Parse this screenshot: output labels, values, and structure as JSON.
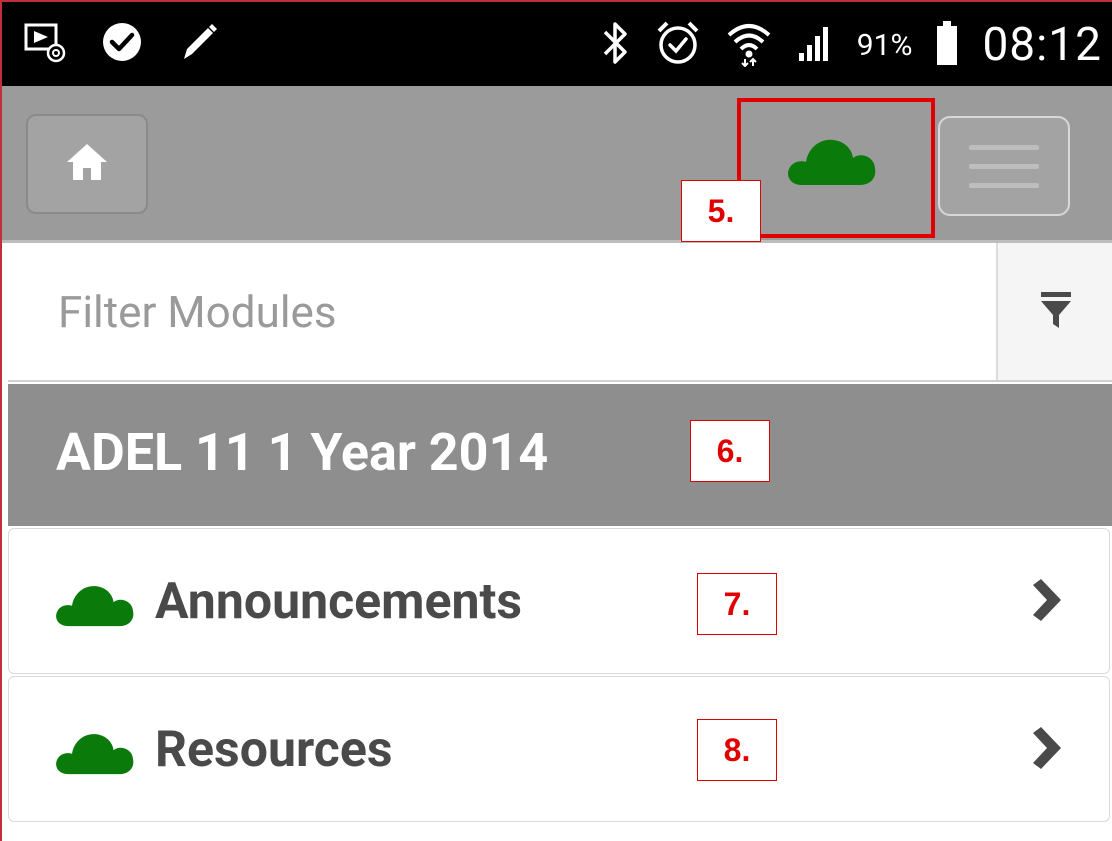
{
  "status_bar": {
    "icons": [
      "screencast-email-icon",
      "skype-icon",
      "pencil-icon",
      "bluetooth-icon",
      "alarm-icon",
      "wifi-icon",
      "signal-icon",
      "battery-icon"
    ],
    "battery": "91%",
    "time": "08:12"
  },
  "toolbar": {
    "home_icon": "home-icon",
    "sync_icon": "cloud-icon",
    "menu_icon": "hamburger-icon"
  },
  "filter": {
    "placeholder": "Filter Modules",
    "value": "",
    "filter_icon": "funnel-icon"
  },
  "section": {
    "title": "ADEL 11 1 Year 2014"
  },
  "items": [
    {
      "label": "Announcements",
      "icon": "cloud-icon",
      "chevron": "chevron-right-icon"
    },
    {
      "label": "Resources",
      "icon": "cloud-icon",
      "chevron": "chevron-right-icon"
    }
  ],
  "annotations": [
    "5.",
    "6.",
    "7.",
    "8."
  ],
  "colors": {
    "cloud": "#0a7a0a",
    "annotation": "#e00000",
    "toolbar": "#9b9b9b",
    "section": "#8e8e8e"
  }
}
